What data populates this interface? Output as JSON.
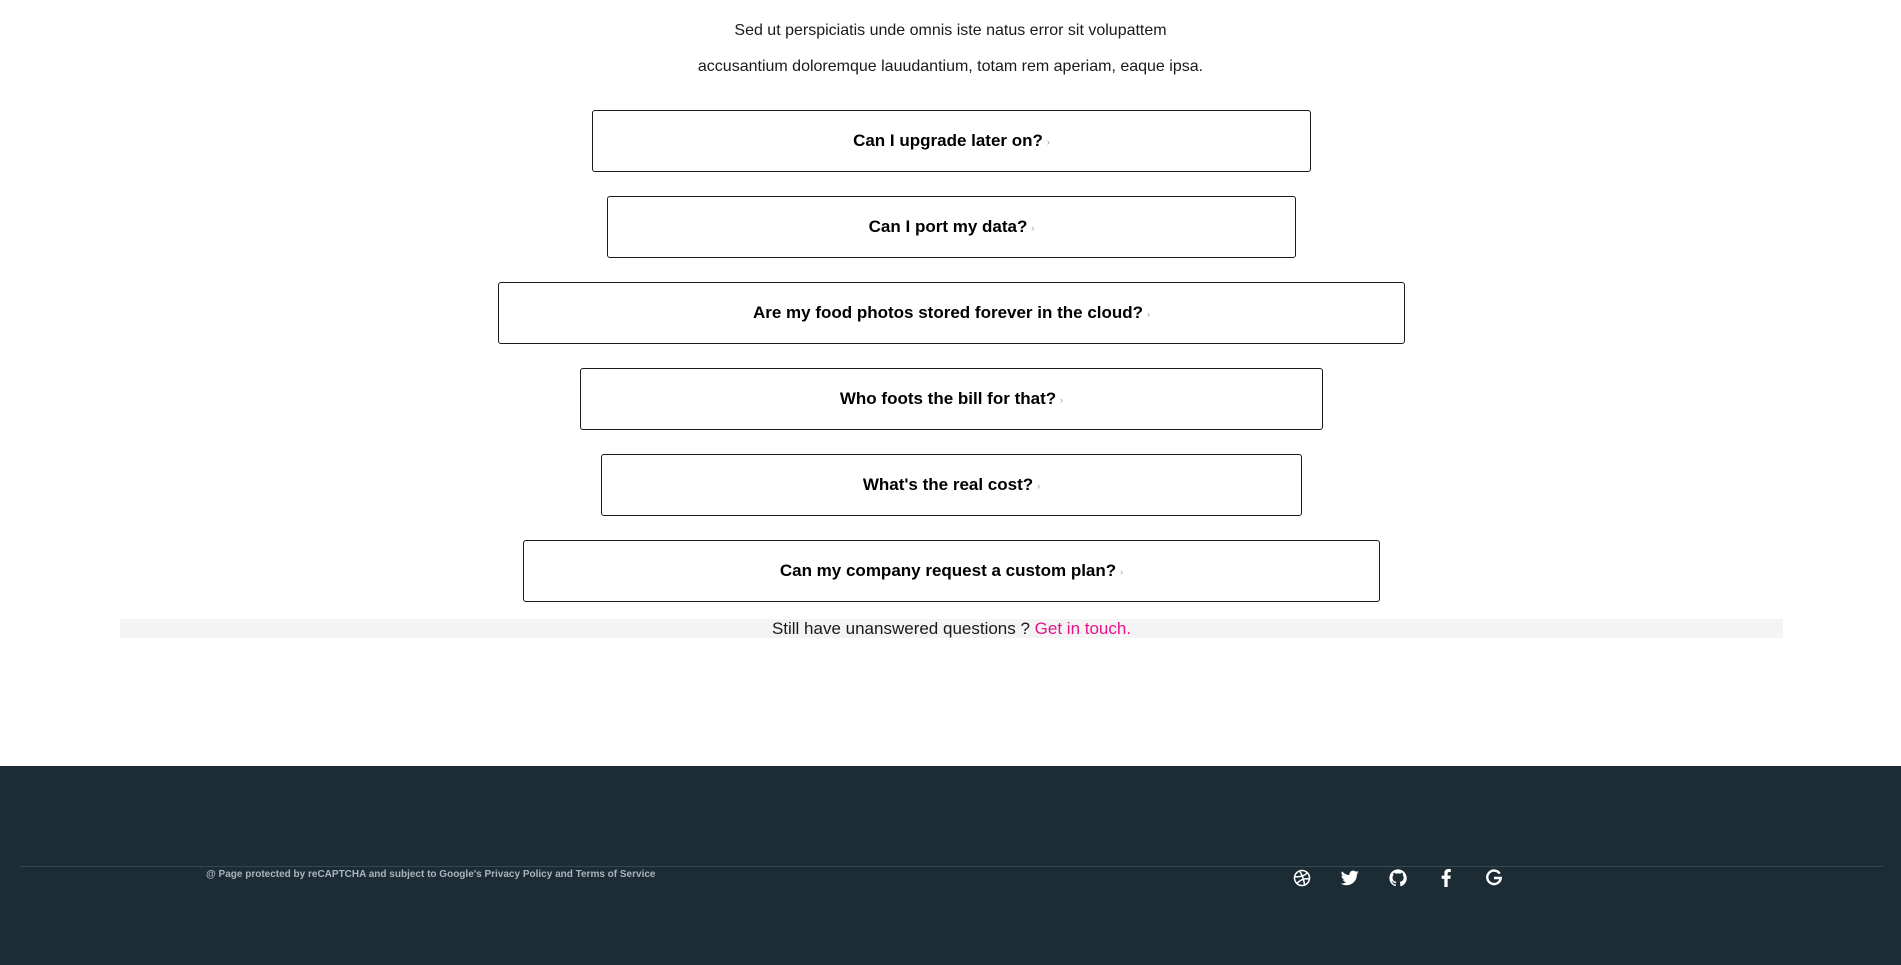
{
  "intro": {
    "line1": "Sed ut perspiciatis unde omnis iste natus error sit volupattem",
    "line2": "accusantium doloremque lauudantium, totam rem aperiam, eaque ipsa."
  },
  "faq": [
    {
      "question": "Can I upgrade later on?",
      "chevron": "›"
    },
    {
      "question": "Can I port my data?",
      "chevron": "›"
    },
    {
      "question": "Are my food photos stored forever in the cloud?",
      "chevron": "›"
    },
    {
      "question": "Who foots the bill for that?",
      "chevron": "›"
    },
    {
      "question": "What's the real cost?",
      "chevron": "›"
    },
    {
      "question": "Can my company request a custom plan?",
      "chevron": "›"
    }
  ],
  "contact": {
    "text": "Still have unanswered questions ?",
    "link": "Get in touch."
  },
  "footer": {
    "legal": "@ Page protected by reCAPTCHA and subject to Google's Privacy Policy and Terms of Service",
    "social_icons": [
      "dribbble-icon",
      "twitter-icon",
      "github-icon",
      "facebook-icon",
      "google-icon"
    ]
  },
  "colors": {
    "accent": "#e6138a",
    "footer_bg": "#1c2c35",
    "contact_bg": "#f4f4f4"
  }
}
